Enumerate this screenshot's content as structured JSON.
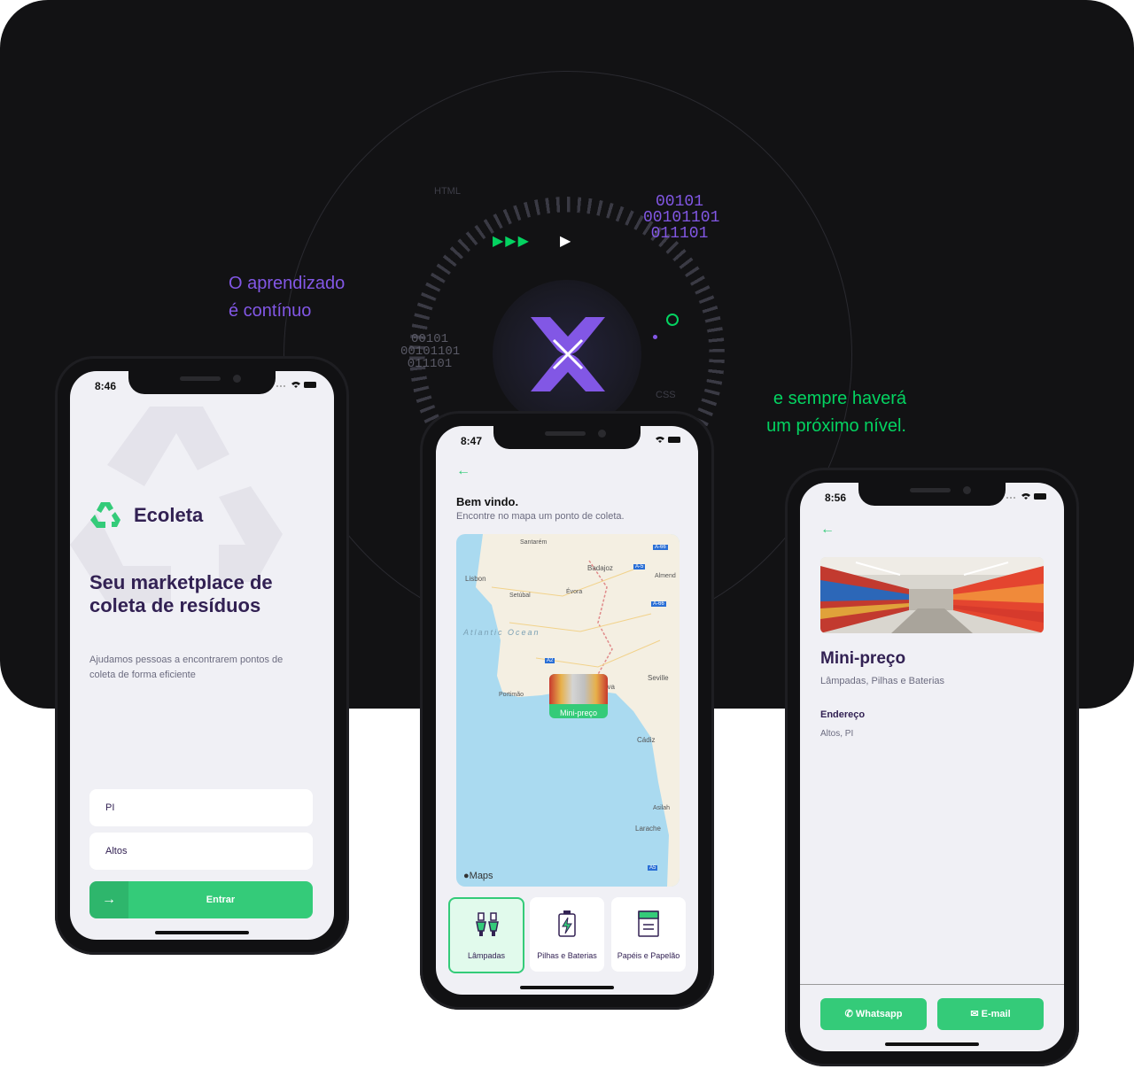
{
  "banner": {
    "tag_html": "HTML",
    "tag_css": "CSS",
    "binary_top": [
      "00101",
      "00101101",
      "011101"
    ],
    "binary_left": [
      "00101",
      "00101101",
      "011101"
    ],
    "quote_left": [
      "O aprendizado",
      "é contínuo"
    ],
    "quote_right": [
      "e sempre haverá",
      "um próximo nível."
    ],
    "colors": {
      "purple": "#8257e5",
      "green": "#04d361",
      "dark": "#121214"
    }
  },
  "phone1": {
    "time": "8:46",
    "app_name": "Ecoleta",
    "headline": "Seu marketplace de coleta de resíduos",
    "description": "Ajudamos pessoas a encontrarem pontos de coleta de forma eficiente",
    "uf_value": "PI",
    "city_value": "Altos",
    "enter_label": "Entrar",
    "icons": {
      "logo": "recycle-icon",
      "enter": "arrow-right-icon"
    }
  },
  "phone2": {
    "time": "8:47",
    "welcome_title": "Bem vindo.",
    "welcome_sub": "Encontre no mapa um ponto de coleta.",
    "map": {
      "labels": [
        "Santarém",
        "Badajoz",
        "Lisbon",
        "Setúbal",
        "Évora",
        "Almend",
        "Atlantic Ocean",
        "Portimão",
        "Huelva",
        "Seville",
        "Cádiz",
        "Asilah",
        "Larache"
      ],
      "roads": [
        "A-66",
        "A-5",
        "A-66",
        "A2",
        "A5"
      ],
      "marker_label": "Mini-preço",
      "attribution": "Maps"
    },
    "categories": [
      {
        "label": "Lâmpadas",
        "icon": "lamp-icon",
        "selected": true
      },
      {
        "label": "Pilhas e Baterias",
        "icon": "battery-icon",
        "selected": false
      },
      {
        "label": "Papéis e Papelão",
        "icon": "paper-icon",
        "selected": false
      }
    ]
  },
  "phone3": {
    "time": "8:56",
    "point_name": "Mini-preço",
    "items": "Lâmpadas, Pilhas e Baterias",
    "address_title": "Endereço",
    "address_value": "Altos, PI",
    "whatsapp_label": "Whatsapp",
    "email_label": "E-mail"
  }
}
